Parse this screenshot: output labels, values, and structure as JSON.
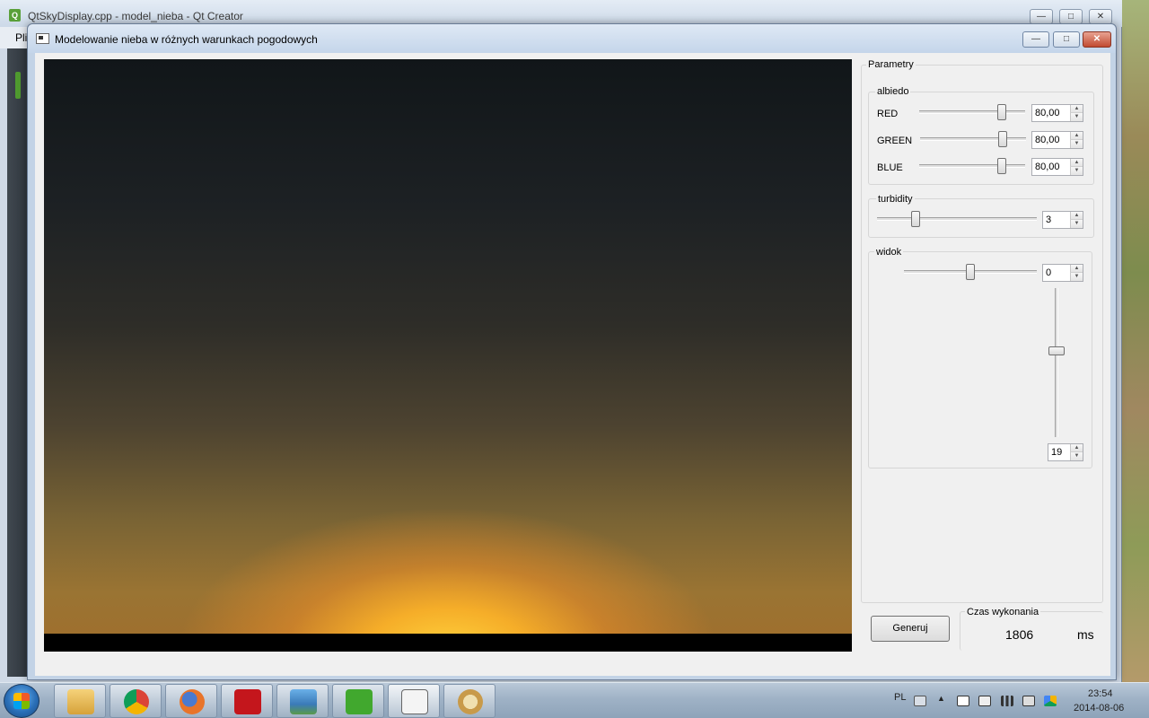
{
  "background_window": {
    "title": "QtSkyDisplay.cpp - model_nieba - Qt Creator",
    "menu_first": "Pli",
    "controls": [
      "—",
      "□",
      "✕"
    ]
  },
  "dialog": {
    "title": "Modelowanie nieba w różnych warunkach pogodowych",
    "controls": {
      "minimize": "—",
      "maximize": "□",
      "close": "✕"
    }
  },
  "params": {
    "title": "Parametry",
    "albedo": {
      "title": "albiedo",
      "rows": [
        {
          "label": "RED",
          "value": "80,00",
          "level": 0.8
        },
        {
          "label": "GREEN",
          "value": "80,00",
          "level": 0.8
        },
        {
          "label": "BLUE",
          "value": "80,00",
          "level": 0.8
        }
      ]
    },
    "turbidity": {
      "title": "turbidity",
      "value": "3",
      "level": 0.28
    },
    "view": {
      "title": "widok",
      "h_value": "0",
      "h_level": 0.5,
      "v_value": "19",
      "v_level": 0.4
    }
  },
  "actions": {
    "generate": "Generuj"
  },
  "timing": {
    "title": "Czas wykonania",
    "value": "1806",
    "unit": "ms"
  },
  "taskbar": {
    "apps": [
      "file-explorer",
      "chrome",
      "firefox",
      "adobe-reader",
      "photo-viewer",
      "qt-creator",
      "sky-app",
      "paint"
    ],
    "language": "PL",
    "time": "23:54",
    "date": "2014-08-06"
  }
}
